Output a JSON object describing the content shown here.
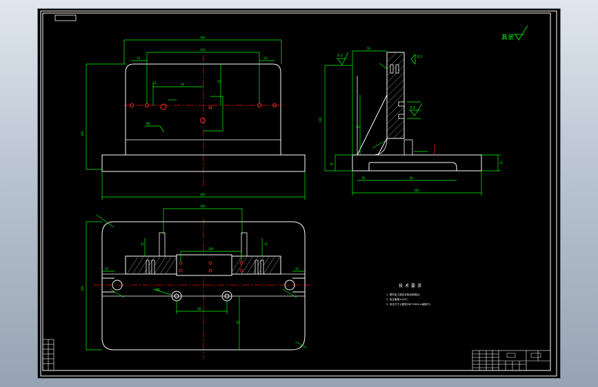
{
  "drawing": {
    "roughness_label": "其余",
    "surface_marks": [
      "3.2",
      "3.2",
      "3.2"
    ],
    "tech_requirements": {
      "title": "技术要求",
      "items": [
        "1. 零件加工前应去除毛刺锐边。",
        "2. 未注倒角1×45°。",
        "3. 未注尺寸公差按GB/T1804-m级执行。"
      ]
    }
  },
  "colors": {
    "background": "#000000",
    "outline": "#ffffff",
    "dimension": "#00ff00",
    "centerline": "#ff0000",
    "hatch": "#a8a8a8"
  }
}
